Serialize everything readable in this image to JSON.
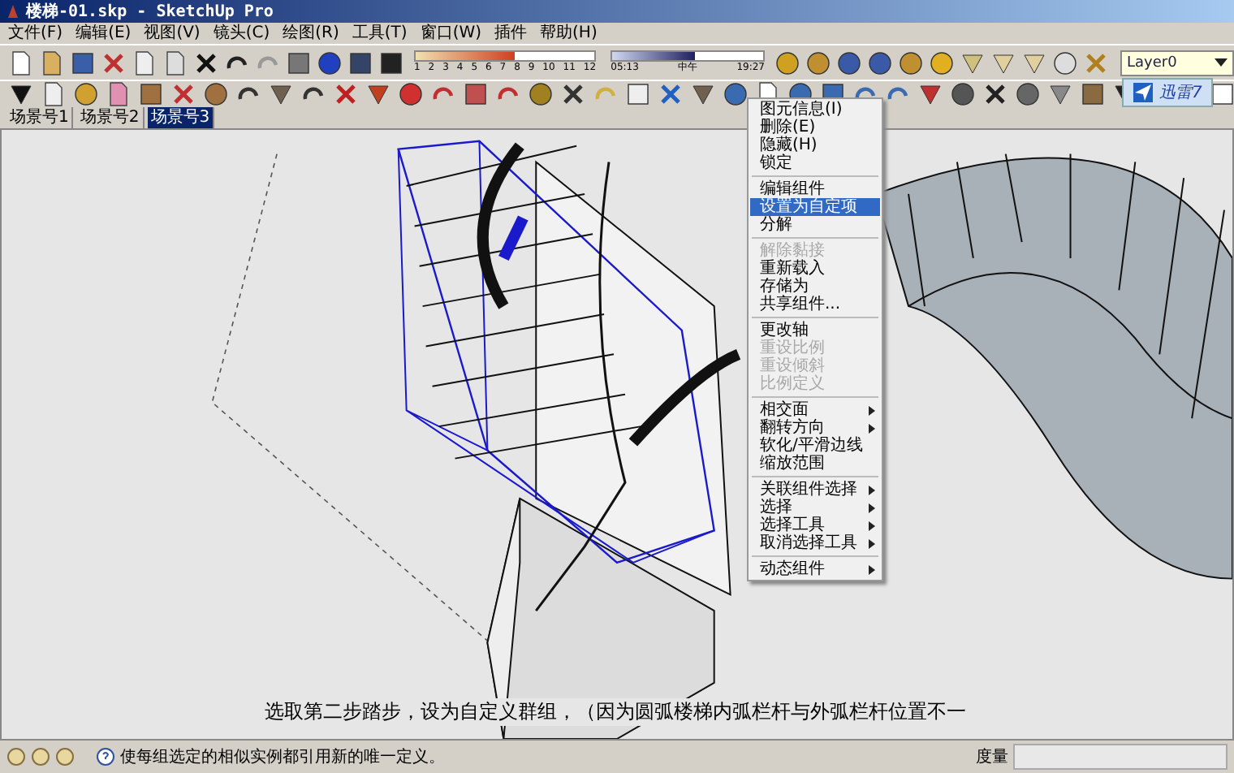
{
  "window": {
    "title": "楼梯-01.skp - SketchUp Pro"
  },
  "menu_bar": [
    "文件(F)",
    "编辑(E)",
    "视图(V)",
    "镜头(C)",
    "绘图(R)",
    "工具(T)",
    "窗口(W)",
    "插件",
    "帮助(H)"
  ],
  "shadow_settings": {
    "date_slider": {
      "labels": [
        "1",
        "2",
        "3",
        "4",
        "5",
        "6",
        "7",
        "8",
        "9",
        "10",
        "11",
        "12"
      ],
      "level": 0.55
    },
    "time_slider": {
      "labels": [
        "05:13",
        "中午",
        "19:27"
      ],
      "level": 0.55
    }
  },
  "layer_dropdown": {
    "value": "Layer0"
  },
  "notification_badge": {
    "label": "迅雷7"
  },
  "scene_tabs": [
    {
      "label": "场景号1",
      "selected": false
    },
    {
      "label": "场景号2",
      "selected": false
    },
    {
      "label": "场景号3",
      "selected": true
    }
  ],
  "context_menu": {
    "groups": [
      [
        {
          "label": "图元信息(I)",
          "disabled": false,
          "submenu": false,
          "selected": false
        },
        {
          "label": "删除(E)",
          "disabled": false,
          "submenu": false,
          "selected": false
        },
        {
          "label": "隐藏(H)",
          "disabled": false,
          "submenu": false,
          "selected": false
        },
        {
          "label": "锁定",
          "disabled": false,
          "submenu": false,
          "selected": false
        }
      ],
      [
        {
          "label": "编辑组件",
          "disabled": false,
          "submenu": false,
          "selected": false
        },
        {
          "label": "设置为自定项",
          "disabled": false,
          "submenu": false,
          "selected": true
        },
        {
          "label": "分解",
          "disabled": false,
          "submenu": false,
          "selected": false
        }
      ],
      [
        {
          "label": "解除黏接",
          "disabled": true,
          "submenu": false,
          "selected": false
        },
        {
          "label": "重新载入",
          "disabled": false,
          "submenu": false,
          "selected": false
        },
        {
          "label": "存储为",
          "disabled": false,
          "submenu": false,
          "selected": false
        },
        {
          "label": "共享组件...",
          "disabled": false,
          "submenu": false,
          "selected": false
        }
      ],
      [
        {
          "label": "更改轴",
          "disabled": false,
          "submenu": false,
          "selected": false
        },
        {
          "label": "重设比例",
          "disabled": true,
          "submenu": false,
          "selected": false
        },
        {
          "label": "重设倾斜",
          "disabled": true,
          "submenu": false,
          "selected": false
        },
        {
          "label": "比例定义",
          "disabled": true,
          "submenu": false,
          "selected": false
        }
      ],
      [
        {
          "label": "相交面",
          "disabled": false,
          "submenu": true,
          "selected": false
        },
        {
          "label": "翻转方向",
          "disabled": false,
          "submenu": true,
          "selected": false
        },
        {
          "label": "软化/平滑边线",
          "disabled": false,
          "submenu": false,
          "selected": false
        },
        {
          "label": "缩放范围",
          "disabled": false,
          "submenu": false,
          "selected": false
        }
      ],
      [
        {
          "label": "关联组件选择",
          "disabled": false,
          "submenu": true,
          "selected": false
        },
        {
          "label": "选择",
          "disabled": false,
          "submenu": true,
          "selected": false
        },
        {
          "label": "选择工具",
          "disabled": false,
          "submenu": true,
          "selected": false
        },
        {
          "label": "取消选择工具",
          "disabled": false,
          "submenu": true,
          "selected": false
        }
      ],
      [
        {
          "label": "动态组件",
          "disabled": false,
          "submenu": true,
          "selected": false
        }
      ]
    ]
  },
  "caption": "选取第二步踏步，设为自定义群组，（因为圆弧楼梯内弧栏杆与外弧栏杆位置不一",
  "status_bar": {
    "hint": "使每组选定的相似实例都引用新的唯一定义。",
    "measurement_label": "度量"
  }
}
